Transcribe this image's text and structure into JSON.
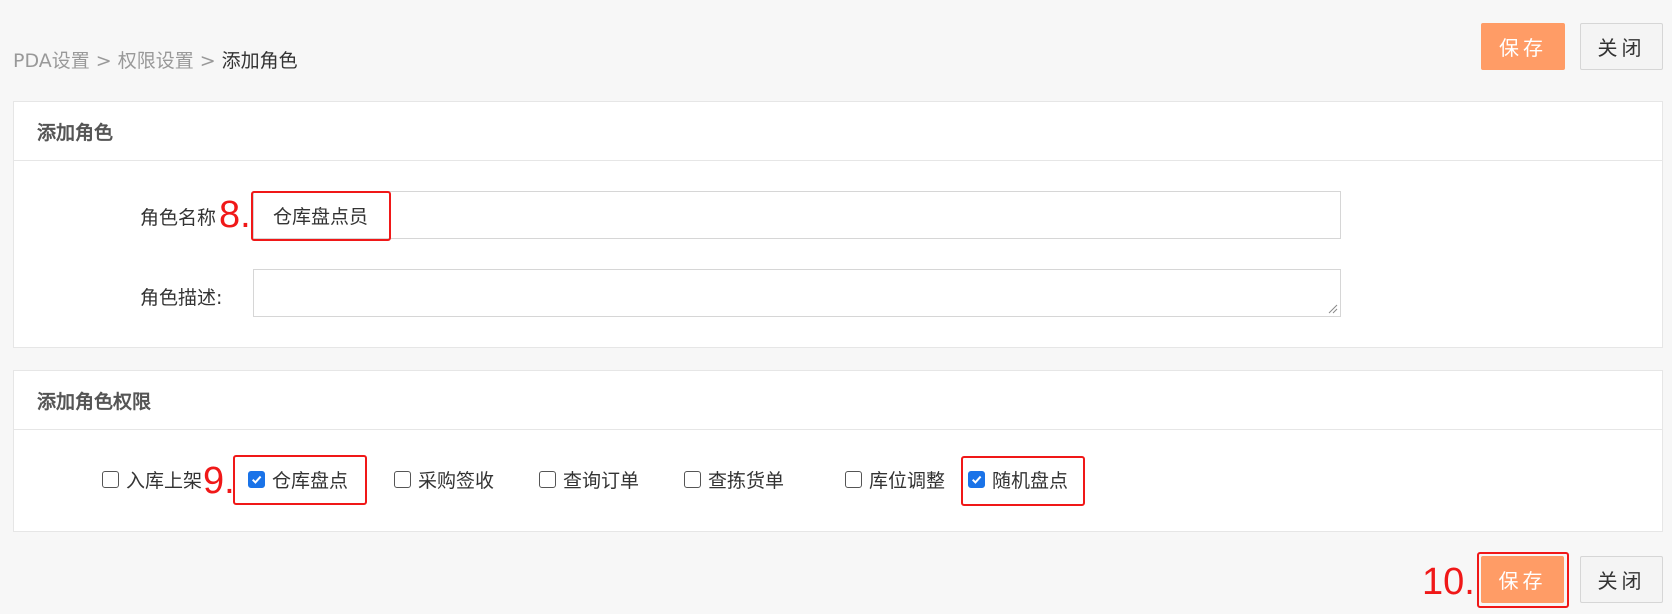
{
  "breadcrumb": {
    "item1": "PDA设置",
    "item2": "权限设置",
    "current": "添加角色",
    "separator": ">"
  },
  "toolbar": {
    "save_label": "保存",
    "close_label": "关闭"
  },
  "role_panel": {
    "title": "添加角色",
    "name_label": "角色名称",
    "name_value": "仓库盘点员",
    "desc_label": "角色描述:",
    "desc_value": ""
  },
  "perm_panel": {
    "title": "添加角色权限",
    "permissions": [
      {
        "label": "入库上架",
        "checked": false
      },
      {
        "label": "仓库盘点",
        "checked": true
      },
      {
        "label": "采购签收",
        "checked": false
      },
      {
        "label": "查询订单",
        "checked": false
      },
      {
        "label": "查拣货单",
        "checked": false
      },
      {
        "label": "库位调整",
        "checked": false
      },
      {
        "label": "随机盘点",
        "checked": true
      }
    ]
  },
  "annotations": {
    "step8": "8.",
    "step9": "9.",
    "step10": "10."
  },
  "colors": {
    "accent": "#ff9c66",
    "annotation": "#f01818",
    "checkbox": "#1a73e8"
  }
}
